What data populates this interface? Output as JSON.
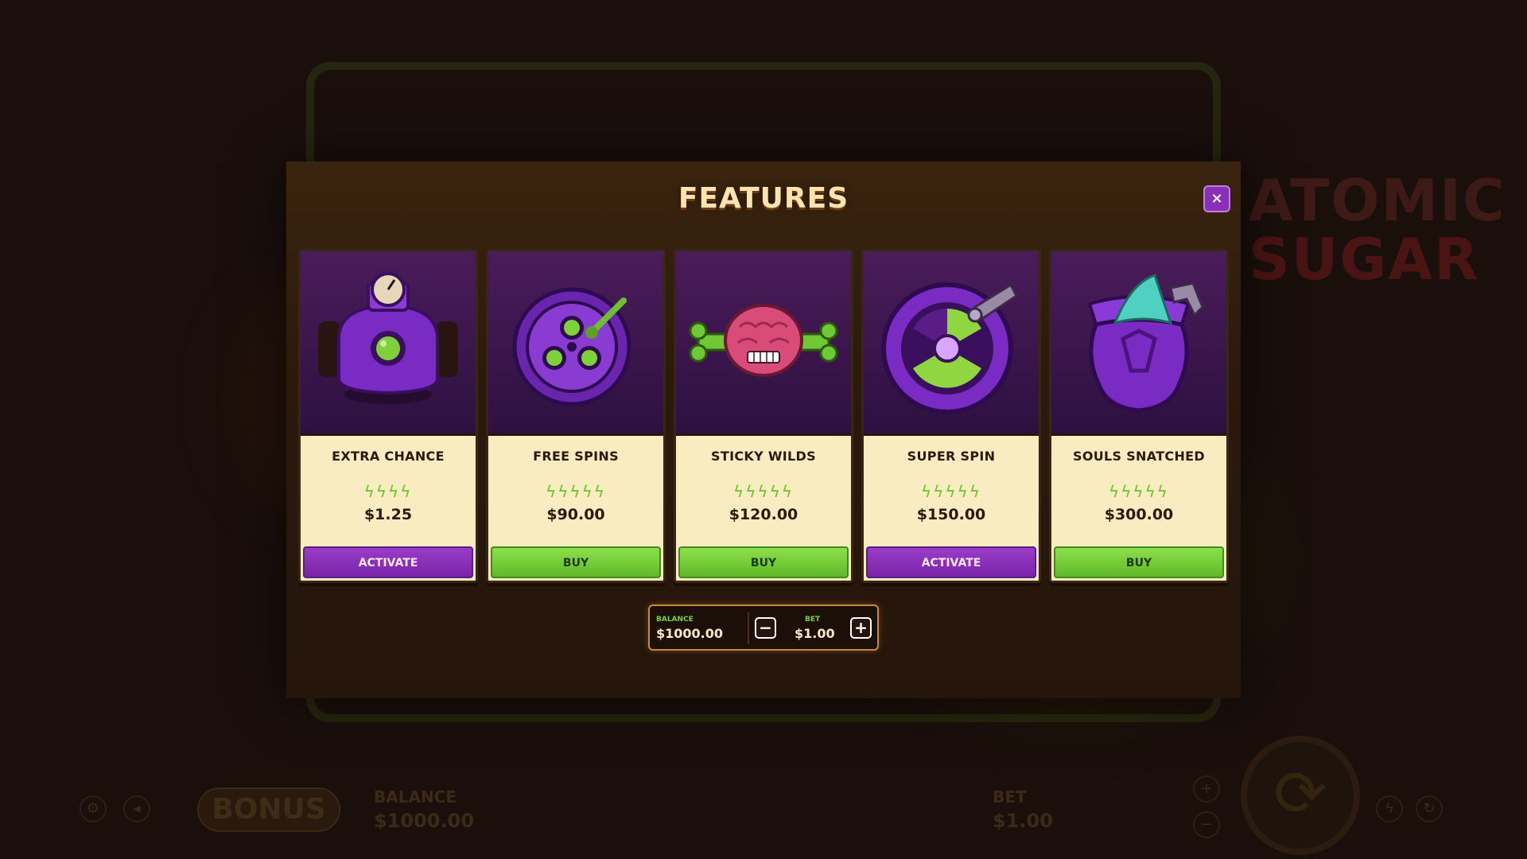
{
  "modal": {
    "title": "FEATURES",
    "close_icon": "×"
  },
  "features": [
    {
      "name": "EXTRA CHANCE",
      "bolts": "ϟϟϟϟ",
      "bolt_count": 4,
      "price": "$1.25",
      "button": "ACTIVATE",
      "button_type": "activate",
      "icon": "bomb-device-icon"
    },
    {
      "name": "FREE SPINS",
      "bolts": "ϟϟϟϟϟ",
      "bolt_count": 5,
      "price": "$90.00",
      "button": "BUY",
      "button_type": "buy",
      "icon": "spin-wheel-icon"
    },
    {
      "name": "STICKY WILDS",
      "bolts": "ϟϟϟϟϟ",
      "bolt_count": 5,
      "price": "$120.00",
      "button": "BUY",
      "button_type": "buy",
      "icon": "brain-icon"
    },
    {
      "name": "SUPER SPIN",
      "bolts": "ϟϟϟϟϟ",
      "bolt_count": 5,
      "price": "$150.00",
      "button": "ACTIVATE",
      "button_type": "activate",
      "icon": "radiation-wheel-icon"
    },
    {
      "name": "SOULS SNATCHED",
      "bolts": "ϟϟϟϟϟ",
      "bolt_count": 5,
      "price": "$300.00",
      "button": "BUY",
      "button_type": "buy",
      "icon": "soul-urn-icon"
    }
  ],
  "bet_bar": {
    "balance_label": "BALANCE",
    "balance_value": "$1000.00",
    "bet_label": "BET",
    "bet_value": "$1.00",
    "minus": "−",
    "plus": "+"
  },
  "background": {
    "logo_line1": "ATOMIC",
    "logo_line2": "SUGAR",
    "bonus_label": "BONUS",
    "balance_label": "BALANCE",
    "balance_value": "$1000.00",
    "bet_label": "BET",
    "bet_value": "$1.00"
  },
  "colors": {
    "activate": "#8a2fb8",
    "buy": "#6fc934",
    "card_bg": "#f8ecc0",
    "bolt": "#66c52a",
    "title": "#fbe3b0"
  }
}
